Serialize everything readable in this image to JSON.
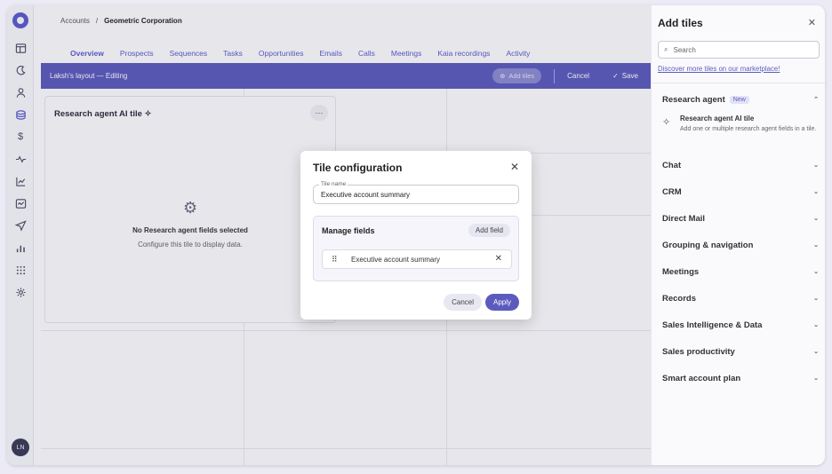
{
  "breadcrumb": {
    "root": "Accounts",
    "sep": "/",
    "current": "Geometric Corporation"
  },
  "tabs": [
    "Overview",
    "Prospects",
    "Sequences",
    "Tasks",
    "Opportunities",
    "Emails",
    "Calls",
    "Meetings",
    "Kaia recordings",
    "Activity"
  ],
  "editbar": {
    "title": "Laksh's layout — Editing",
    "add_tiles": "Add tiles",
    "cancel": "Cancel",
    "save": "Save"
  },
  "tile": {
    "title": "Research agent AI tile",
    "more": "···",
    "empty_title": "No Research agent fields selected",
    "empty_sub": "Configure this tile to display data."
  },
  "modal": {
    "title": "Tile configuration",
    "name_label": "Tile name",
    "name_value": "Executive account summary",
    "manage_title": "Manage fields",
    "add_field": "Add field",
    "field_row": "Executive account summary",
    "cancel": "Cancel",
    "apply": "Apply"
  },
  "panel": {
    "title": "Add tiles",
    "search_placeholder": "Search",
    "marketplace": "Discover more tiles on our marketplace!",
    "research_agent": {
      "label": "Research agent",
      "badge": "New",
      "item_title": "Research agent AI tile",
      "item_desc": "Add one or multiple research agent fields in a tile."
    },
    "sections": [
      "Chat",
      "CRM",
      "Direct Mail",
      "Grouping & navigation",
      "Meetings",
      "Records",
      "Sales Intelligence & Data",
      "Sales productivity",
      "Smart account plan"
    ]
  },
  "user": {
    "initials": "LN"
  },
  "colors": {
    "accent": "#5b5bbe"
  }
}
